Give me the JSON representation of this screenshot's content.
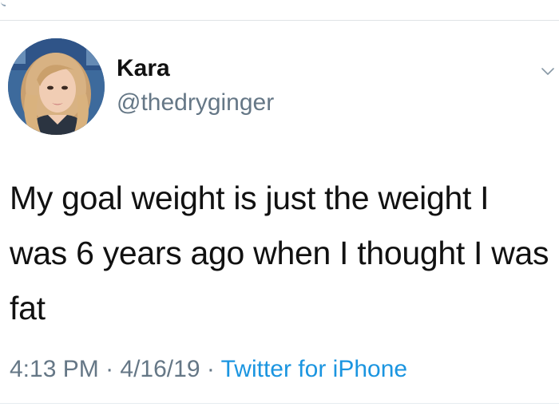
{
  "tweet": {
    "author": {
      "display_name": "Kara",
      "handle": "@thedryginger",
      "avatar_icon": "user-avatar"
    },
    "text": "My goal weight is just the weight I was 6 years ago when I thought I was fat",
    "meta": {
      "time": "4:13 PM",
      "separator": " · ",
      "date": "4/16/19",
      "source": "Twitter for iPhone"
    },
    "menu_icon": "chevron-down-icon"
  },
  "colors": {
    "text": "#14171a",
    "secondary": "#657786",
    "link": "#1b95e0",
    "divider": "#e6ecf0"
  }
}
